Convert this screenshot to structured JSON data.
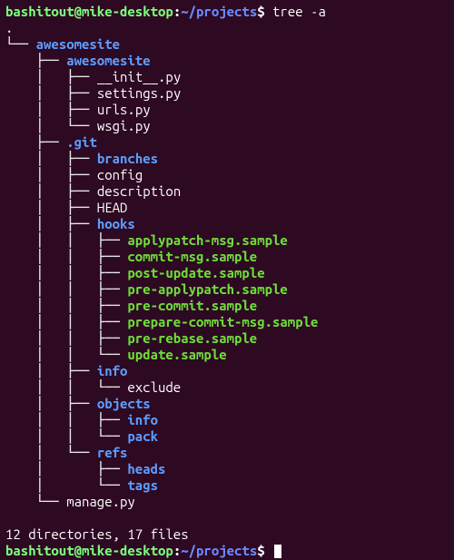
{
  "prompt": {
    "user_host": "bashitout@mike-desktop",
    "colon": ":",
    "path": "~/projects",
    "dollar": "$"
  },
  "command": " tree -a",
  "tree": {
    "root": ".",
    "lines": [
      {
        "prefix": "└── ",
        "name": "awesomesite",
        "type": "dir"
      },
      {
        "prefix": "    ├── ",
        "name": "awesomesite",
        "type": "dir"
      },
      {
        "prefix": "    │   ├── ",
        "name": "__init__.py",
        "type": "file"
      },
      {
        "prefix": "    │   ├── ",
        "name": "settings.py",
        "type": "file"
      },
      {
        "prefix": "    │   ├── ",
        "name": "urls.py",
        "type": "file"
      },
      {
        "prefix": "    │   └── ",
        "name": "wsgi.py",
        "type": "file"
      },
      {
        "prefix": "    ├── ",
        "name": ".git",
        "type": "dir"
      },
      {
        "prefix": "    │   ├── ",
        "name": "branches",
        "type": "dir"
      },
      {
        "prefix": "    │   ├── ",
        "name": "config",
        "type": "file"
      },
      {
        "prefix": "    │   ├── ",
        "name": "description",
        "type": "file"
      },
      {
        "prefix": "    │   ├── ",
        "name": "HEAD",
        "type": "file"
      },
      {
        "prefix": "    │   ├── ",
        "name": "hooks",
        "type": "dir"
      },
      {
        "prefix": "    │   │   ├── ",
        "name": "applypatch-msg.sample",
        "type": "exec"
      },
      {
        "prefix": "    │   │   ├── ",
        "name": "commit-msg.sample",
        "type": "exec"
      },
      {
        "prefix": "    │   │   ├── ",
        "name": "post-update.sample",
        "type": "exec"
      },
      {
        "prefix": "    │   │   ├── ",
        "name": "pre-applypatch.sample",
        "type": "exec"
      },
      {
        "prefix": "    │   │   ├── ",
        "name": "pre-commit.sample",
        "type": "exec"
      },
      {
        "prefix": "    │   │   ├── ",
        "name": "prepare-commit-msg.sample",
        "type": "exec"
      },
      {
        "prefix": "    │   │   ├── ",
        "name": "pre-rebase.sample",
        "type": "exec"
      },
      {
        "prefix": "    │   │   └── ",
        "name": "update.sample",
        "type": "exec"
      },
      {
        "prefix": "    │   ├── ",
        "name": "info",
        "type": "dir"
      },
      {
        "prefix": "    │   │   └── ",
        "name": "exclude",
        "type": "file"
      },
      {
        "prefix": "    │   ├── ",
        "name": "objects",
        "type": "dir"
      },
      {
        "prefix": "    │   │   ├── ",
        "name": "info",
        "type": "dir"
      },
      {
        "prefix": "    │   │   └── ",
        "name": "pack",
        "type": "dir"
      },
      {
        "prefix": "    │   └── ",
        "name": "refs",
        "type": "dir"
      },
      {
        "prefix": "    │       ├── ",
        "name": "heads",
        "type": "dir"
      },
      {
        "prefix": "    │       └── ",
        "name": "tags",
        "type": "dir"
      },
      {
        "prefix": "    └── ",
        "name": "manage.py",
        "type": "file"
      }
    ]
  },
  "summary": "12 directories, 17 files"
}
